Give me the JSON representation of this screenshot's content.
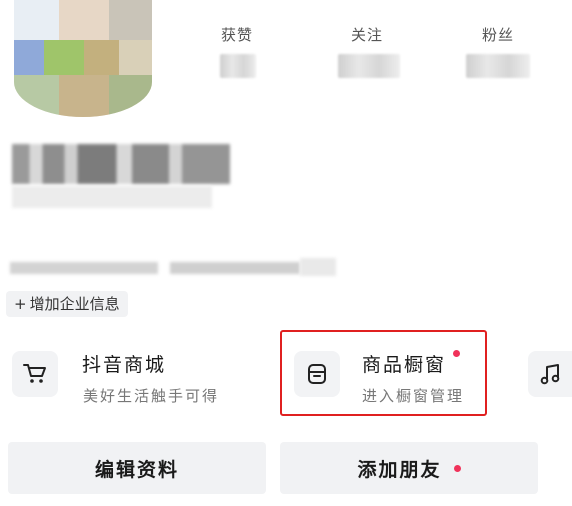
{
  "profile": {
    "stats": [
      {
        "label": "获赞"
      },
      {
        "label": "关注"
      },
      {
        "label": "粉丝"
      }
    ],
    "add_enterprise_label": "增加企业信息"
  },
  "features": {
    "mall": {
      "title": "抖音商城",
      "subtitle": "美好生活触手可得",
      "icon": "cart-icon"
    },
    "showcase": {
      "title": "商品橱窗",
      "subtitle": "进入橱窗管理",
      "icon": "storefront-icon"
    },
    "music": {
      "icon": "music-note-icon"
    }
  },
  "buttons": {
    "edit_profile": "编辑资料",
    "add_friend": "添加朋友"
  },
  "colors": {
    "highlight": "#e02020",
    "badge": "#f0325a"
  }
}
